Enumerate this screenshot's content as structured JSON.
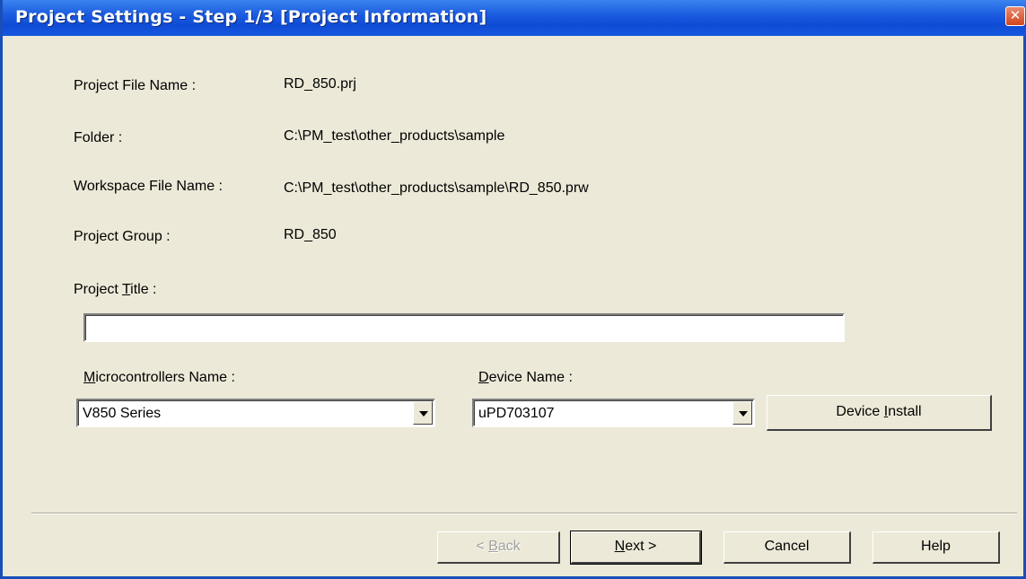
{
  "window": {
    "title": "Project Settings - Step 1/3 [Project Information]",
    "close_symbol": "✕"
  },
  "fields": {
    "project_file_name_label": "Project File Name :",
    "project_file_name_value": "RD_850.prj",
    "folder_label": "Folder :",
    "folder_value": "C:\\PM_test\\other_products\\sample",
    "workspace_label": "Workspace File Name :",
    "workspace_value": "C:\\PM_test\\other_products\\sample\\RD_850.prw",
    "project_group_label": "Project Group :",
    "project_group_value": "RD_850",
    "project_title_label_pre": "Project ",
    "project_title_label_key": "T",
    "project_title_label_post": "itle :",
    "project_title_value": ""
  },
  "microcontroller": {
    "label_key": "M",
    "label_post": "icrocontrollers Name :",
    "selected": "V850 Series"
  },
  "device": {
    "label_key": "D",
    "label_post": "evice Name :",
    "selected": "uPD703107",
    "install_pre": "Device ",
    "install_key": "I",
    "install_post": "nstall"
  },
  "buttons": {
    "back_pre": "< ",
    "back_key": "B",
    "back_post": "ack",
    "next_key": "N",
    "next_post": "ext >",
    "cancel": "Cancel",
    "help": "Help"
  }
}
